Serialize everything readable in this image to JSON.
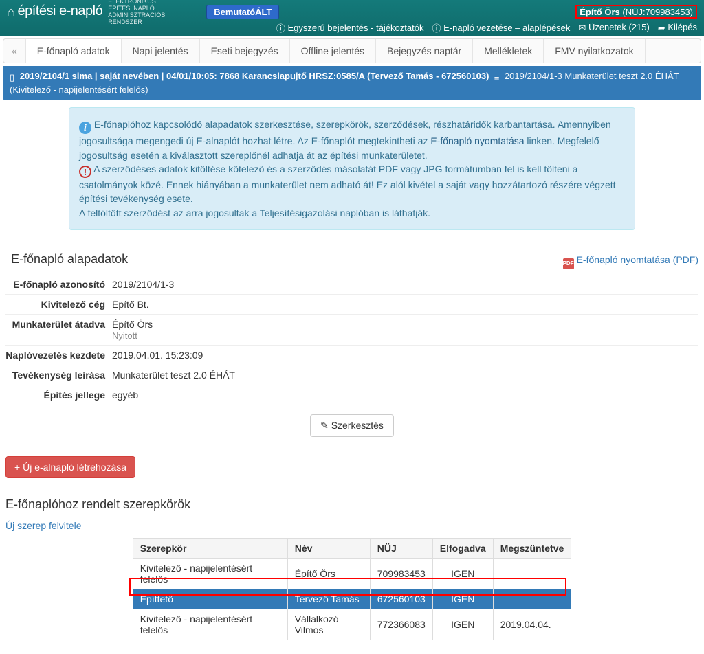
{
  "header": {
    "logo_main": "építési e-napló",
    "logo_sub_l1": "ELEKTRONIKUS",
    "logo_sub_l2": "ÉPÍTÉSI NAPLÓ",
    "logo_sub_l3": "ADMINISZTRÁCIÓS",
    "logo_sub_l4": "RENDSZER",
    "demo_badge": "BemutatóÁLT",
    "user_name": "Építő Örs",
    "user_nuj_label": "(NÜJ:709983453)",
    "link_simple": "Egyszerű bejelentés - tájékoztatók",
    "link_guide": "E-napló vezetése – alaplépések",
    "link_messages": "Üzenetek (215)",
    "link_logout": "Kilépés"
  },
  "tabs": {
    "back": "«",
    "t0": "E-főnapló adatok",
    "t1": "Napi jelentés",
    "t2": "Eseti bejegyzés",
    "t3": "Offline jelentés",
    "t4": "Bejegyzés naptár",
    "t5": "Mellékletek",
    "t6": "FMV nyilatkozatok"
  },
  "crumb": {
    "seg1": "2019/2104/1 sima | saját nevében | 04/01/10:05: 7868 Karancslapujtő HRSZ:0585/A (Tervező Tamás - 672560103)",
    "seg2": "2019/2104/1-3 Munkaterület teszt 2.0 ÉHÁT (Kivitelező - napijelentésért felelős)"
  },
  "info": {
    "p1a": "E-főnaplóhoz kapcsolódó alapadatok szerkesztése, szerepkörök, szerződések, részhatáridők karbantartása. Amennyiben jogosultsága megengedi új E-alnaplót hozhat létre. Az E-főnaplót megtekintheti az ",
    "p1link": "E-főnapló nyomtatása",
    "p1b": " linken. Megfelelő jogosultság esetén a kiválasztott szereplőnél adhatja át az építési munkaterületet.",
    "p2": "A szerződéses adatok kitöltése kötelező és a szerződés másolatát PDF vagy JPG formátumban fel is kell tölteni a csatolmányok közé. Ennek hiányában a munkaterület nem adható át! Ez alól kivétel a saját vagy hozzátartozó részére végzett építési tevékenység esete.",
    "p3": "A feltöltött szerződést az arra jogosultak a Teljesítésigazolási naplóban is láthatják."
  },
  "section_alap": "E-főnapló alapadatok",
  "pdf_link": "E-főnapló nyomtatása (PDF)",
  "kv": {
    "l_id": "E-főnapló azonosító",
    "v_id": "2019/2104/1-3",
    "l_ceg": "Kivitelező cég",
    "v_ceg": "Építő Bt.",
    "l_mt": "Munkaterület átadva",
    "v_mt": "Építő Örs",
    "v_mt_sub": "Nyitott",
    "l_start": "Naplóvezetés kezdete",
    "v_start": "2019.04.01. 15:23:09",
    "l_tev": "Tevékenység leírása",
    "v_tev": "Munkaterület teszt 2.0 ÉHÁT",
    "l_jell": "Építés jellege",
    "v_jell": "egyéb"
  },
  "btn_edit": "Szerkesztés",
  "btn_new_sub": "Új e-alnapló létrehozása",
  "section_roles": "E-főnaplóhoz rendelt szerepkörök",
  "link_new_role": "Új szerep felvitele",
  "roles": {
    "h_role": "Szerepkör",
    "h_name": "Név",
    "h_nuj": "NÜJ",
    "h_acc": "Elfogadva",
    "h_end": "Megszüntetve",
    "r0_role": "Kivitelező - napijelentésért felelős",
    "r0_name": "Építő Örs",
    "r0_nuj": "709983453",
    "r0_acc": "IGEN",
    "r0_end": "",
    "r1_role": "Építtető",
    "r1_name": "Tervező Tamás",
    "r1_nuj": "672560103",
    "r1_acc": "IGEN",
    "r1_end": "",
    "r2_role": "Kivitelező - napijelentésért felelős",
    "r2_name": "Vállalkozó Vilmos",
    "r2_nuj": "772366083",
    "r2_acc": "IGEN",
    "r2_end": "2019.04.04."
  }
}
